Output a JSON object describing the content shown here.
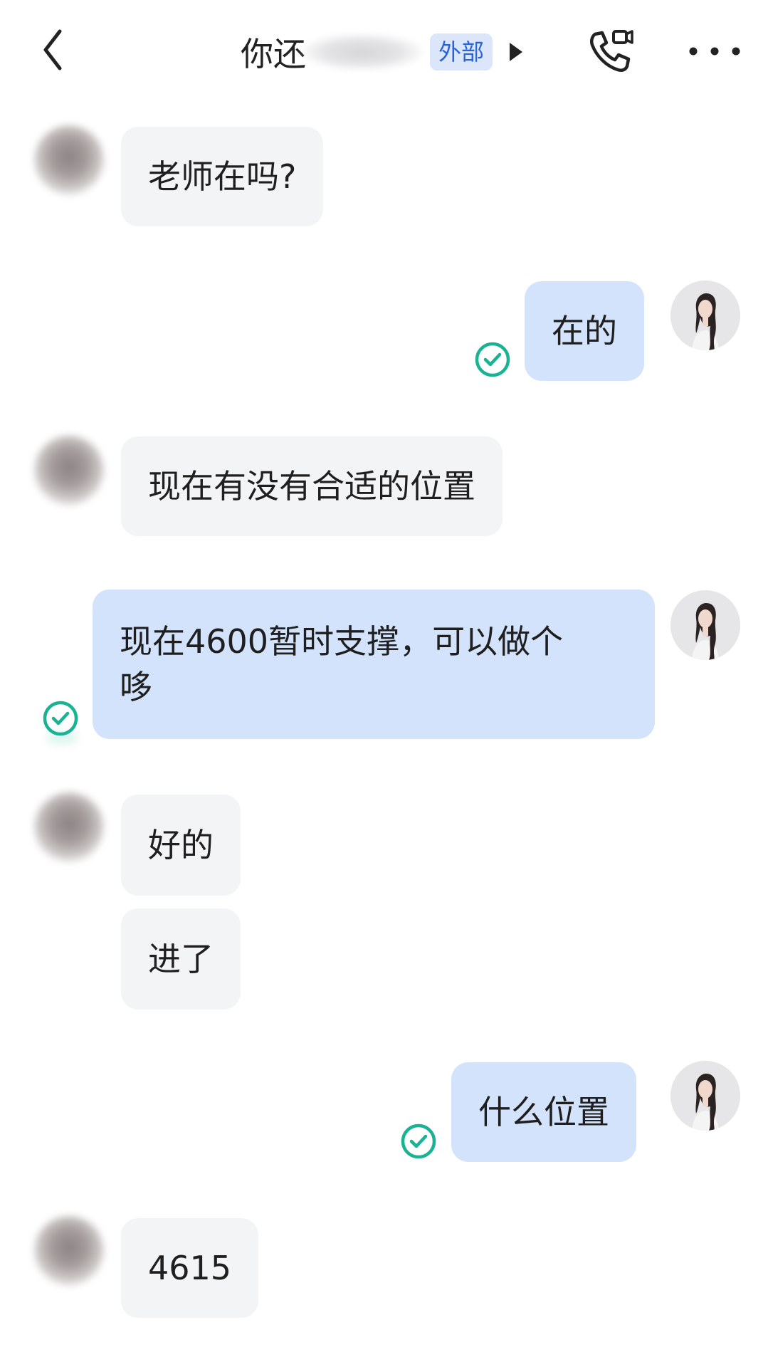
{
  "header": {
    "title_visible": "你还",
    "badge": "外部",
    "icons": {
      "back": "chevron-left-icon",
      "arrow": "play-right-icon",
      "call": "phone-video-icon",
      "more": "more-horizontal-icon"
    }
  },
  "messages": [
    {
      "side": "in",
      "text": "老师在吗?"
    },
    {
      "side": "out",
      "text": "在的",
      "read": true
    },
    {
      "side": "in",
      "text": "现在有没有合适的位置"
    },
    {
      "side": "out",
      "lines": [
        "现在4600暂时支撑，可以做个",
        "哆"
      ],
      "read": true
    },
    {
      "side": "in",
      "text": "好的"
    },
    {
      "side": "in",
      "text": "进了"
    },
    {
      "side": "out",
      "text": "什么位置",
      "read": true
    },
    {
      "side": "in",
      "text": "4615"
    }
  ],
  "colors": {
    "incoming_bubble": "#f3f4f6",
    "outgoing_bubble": "#d3e3fc",
    "badge_bg": "#dbe6fb",
    "badge_text": "#2a63d6",
    "read_check": "#19b394"
  }
}
